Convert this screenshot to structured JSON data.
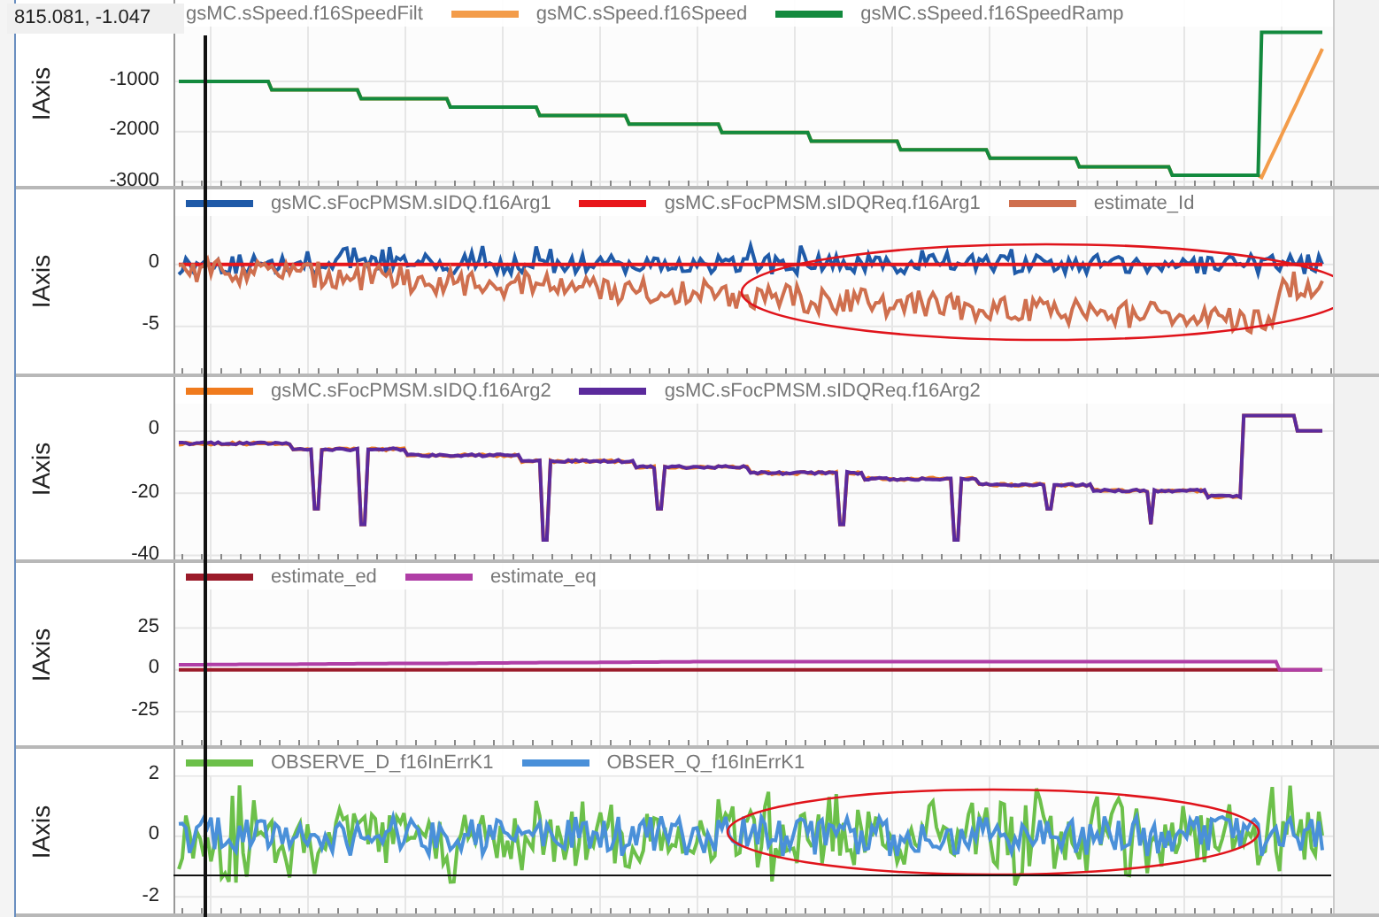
{
  "cursor_readout": "815.081, -1.047",
  "panels": [
    {
      "axis_label": "IAxis",
      "yticks": [
        "-1000",
        "-2000",
        "-3000"
      ],
      "legend": [
        {
          "label": "gsMC.sSpeed.f16SpeedFilt",
          "kind": "none"
        },
        {
          "label": "gsMC.sSpeed.f16Speed",
          "color": "#f39c4a",
          "kind": "staircase"
        },
        {
          "label": "gsMC.sSpeed.f16SpeedRamp",
          "color": "#138a3e",
          "kind": "staircase-jump"
        }
      ]
    },
    {
      "axis_label": "IAxis",
      "circled": true,
      "yticks": [
        "0",
        "-5"
      ],
      "legend": [
        {
          "label": "gsMC.sFocPMSM.sIDQ.f16Arg1",
          "color": "#1f5aa8",
          "kind": "noise"
        },
        {
          "label": "gsMC.sFocPMSM.sIDQReq.f16Arg1",
          "color": "#e8161b",
          "kind": "flat"
        },
        {
          "label": "estimate_Id",
          "color": "#cf6f4e",
          "kind": "drift-noise"
        }
      ]
    },
    {
      "axis_label": "IAxis",
      "yticks": [
        "0",
        "-20",
        "-40"
      ],
      "legend": [
        {
          "label": "gsMC.sFocPMSM.sIDQ.f16Arg2",
          "color": "#f07b1e",
          "kind": "spiky-steps"
        },
        {
          "label": "gsMC.sFocPMSM.sIDQReq.f16Arg2",
          "color": "#5b2a9c",
          "kind": "spiky-steps"
        }
      ]
    },
    {
      "axis_label": "IAxis",
      "yticks": [
        "25",
        "0",
        "-25"
      ],
      "legend": [
        {
          "label": "estimate_ed",
          "color": "#9b1b2a",
          "kind": "flat"
        },
        {
          "label": "estimate_eq",
          "color": "#b03ea6",
          "kind": "plateau"
        }
      ]
    },
    {
      "axis_label": "IAxis",
      "circled": true,
      "yticks": [
        "2",
        "0",
        "-2"
      ],
      "legend": [
        {
          "label": "OBSERVE_D_f16InErrK1",
          "color": "#6cc04a",
          "kind": "wide-noise"
        },
        {
          "label": "OBSER_Q_f16InErrK1",
          "color": "#4a90d9",
          "kind": "noise-small"
        }
      ]
    }
  ]
}
